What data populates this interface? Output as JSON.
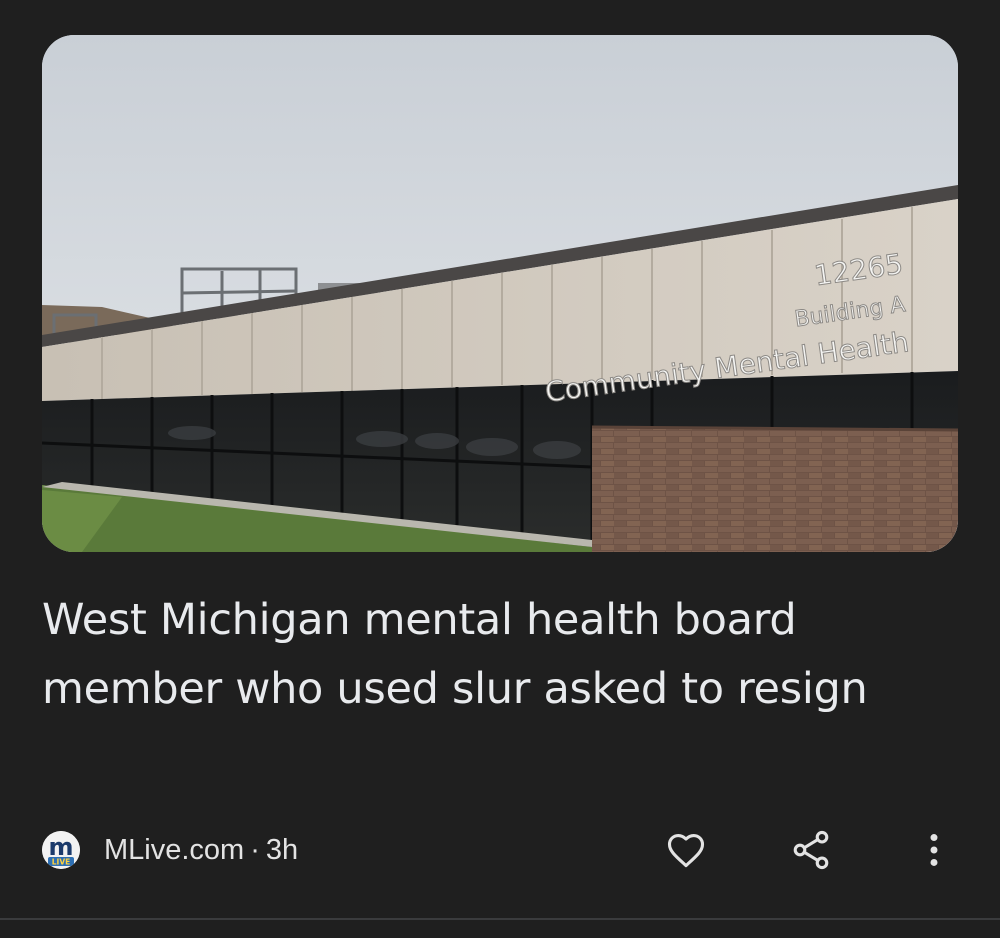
{
  "article": {
    "image_alt": "Community Mental Health building",
    "sign": {
      "number": "12265",
      "building": "Building A",
      "name": "Community Mental Health"
    },
    "headline": "West Michigan mental health board member who used slur asked to resign",
    "source": {
      "name": "MLive.com",
      "separator": "·",
      "age": "3h",
      "logo_letter": "m",
      "logo_subtext": "LIVE"
    }
  },
  "actions": {
    "like_icon": "heart-outline-icon",
    "share_icon": "share-icon",
    "more_icon": "more-vert-icon"
  },
  "colors": {
    "background": "#1f1f1f",
    "text_primary": "#e8eaed",
    "icon": "#e3e3e3",
    "divider": "#3a3b3d"
  }
}
